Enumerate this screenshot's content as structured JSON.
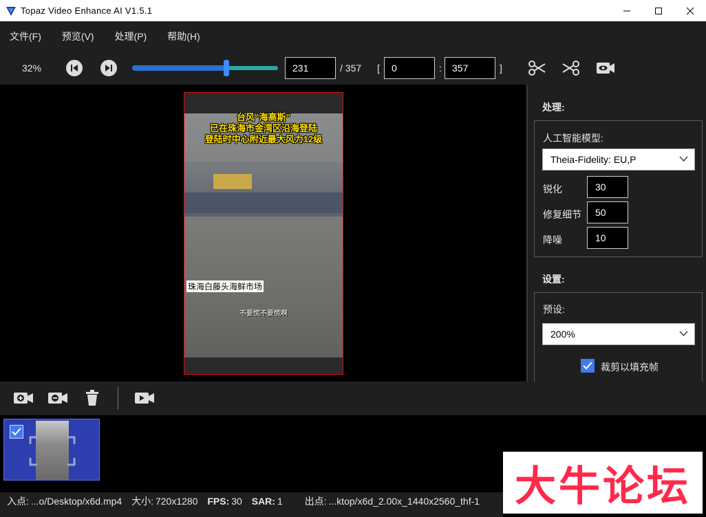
{
  "window": {
    "title": "Topaz Video Enhance AI V1.5.1"
  },
  "menu": {
    "items": [
      "文件(F)",
      "预览(V)",
      "处理(P)",
      "帮助(H)"
    ]
  },
  "toolbar": {
    "zoom": "32%",
    "slider_progress": 0.647,
    "current_frame": "231",
    "total_frames": "/ 357",
    "range_open": "[",
    "range_start": "0",
    "range_colon": ":",
    "range_end": "357",
    "range_close": "]"
  },
  "preview": {
    "caption_line1": "台风“海高斯”",
    "caption_line2": "已在珠海市金湾区沿海登陆",
    "caption_line3": "登陆时中心附近最大风力12级",
    "location_label": "珠海白藤头海鲜市场",
    "subtitle": "不要慌不要慌啊"
  },
  "panel": {
    "processing_title": "处理:",
    "ai_model_label": "人工智能模型:",
    "ai_model_value": "Theia-Fidelity: EU,P",
    "sharpen_label": "锐化",
    "sharpen_value": "30",
    "restore_label": "修复细节",
    "restore_value": "50",
    "denoise_label": "降噪",
    "denoise_value": "10",
    "settings_title": "设置:",
    "preset_label": "预设:",
    "preset_value": "200%",
    "crop_label": "裁剪以填充帧",
    "crop_checked": true
  },
  "status": {
    "in_label": "入点:",
    "in_value": "...o/Desktop/x6d.mp4",
    "size_label": "大小:",
    "size_value": "720x1280",
    "fps_label": "FPS:",
    "fps_value": "30",
    "sar_label": "SAR:",
    "sar_value": "1",
    "out_label": "出点:",
    "out_value": "...ktop/x6d_2.00x_1440x2560_thf-1"
  },
  "watermark": {
    "text": "大牛论坛"
  },
  "colors": {
    "accent": "#3e7cf0",
    "frame_border": "#dd1111",
    "watermark": "#ff2a4b"
  }
}
